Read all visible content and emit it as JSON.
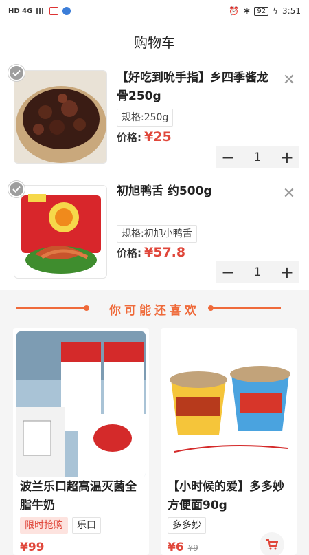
{
  "status_bar": {
    "left_icons": [
      "hd-icon",
      "signal-icon",
      "app-icon",
      "browser-icon"
    ],
    "left_text": "HD 4G",
    "battery": "92",
    "time": "3:51"
  },
  "header": {
    "title": "购物车"
  },
  "cart": {
    "items": [
      {
        "title": "【好吃到吮手指】乡四季酱龙骨250g",
        "spec": "规格:250g",
        "price_label": "价格:",
        "price": "¥25",
        "quantity": "1"
      },
      {
        "title": "初旭鸭舌 约500g",
        "spec": "规格:初旭小鸭舌",
        "price_label": "价格:",
        "price": "¥57.8",
        "quantity": "1"
      }
    ]
  },
  "recommend": {
    "title": "你可能还喜欢",
    "products": [
      {
        "title": "波兰乐口超高温灭菌全脂牛奶",
        "tags": [
          "限时抢购",
          "乐口"
        ],
        "price": "¥99"
      },
      {
        "title": "【小时候的爱】多多妙方便面90g",
        "tags": [
          "多多妙"
        ],
        "price": "¥6",
        "original_price": "¥9"
      }
    ]
  },
  "colors": {
    "accent": "#e0473b",
    "section": "#ef6a3a"
  }
}
